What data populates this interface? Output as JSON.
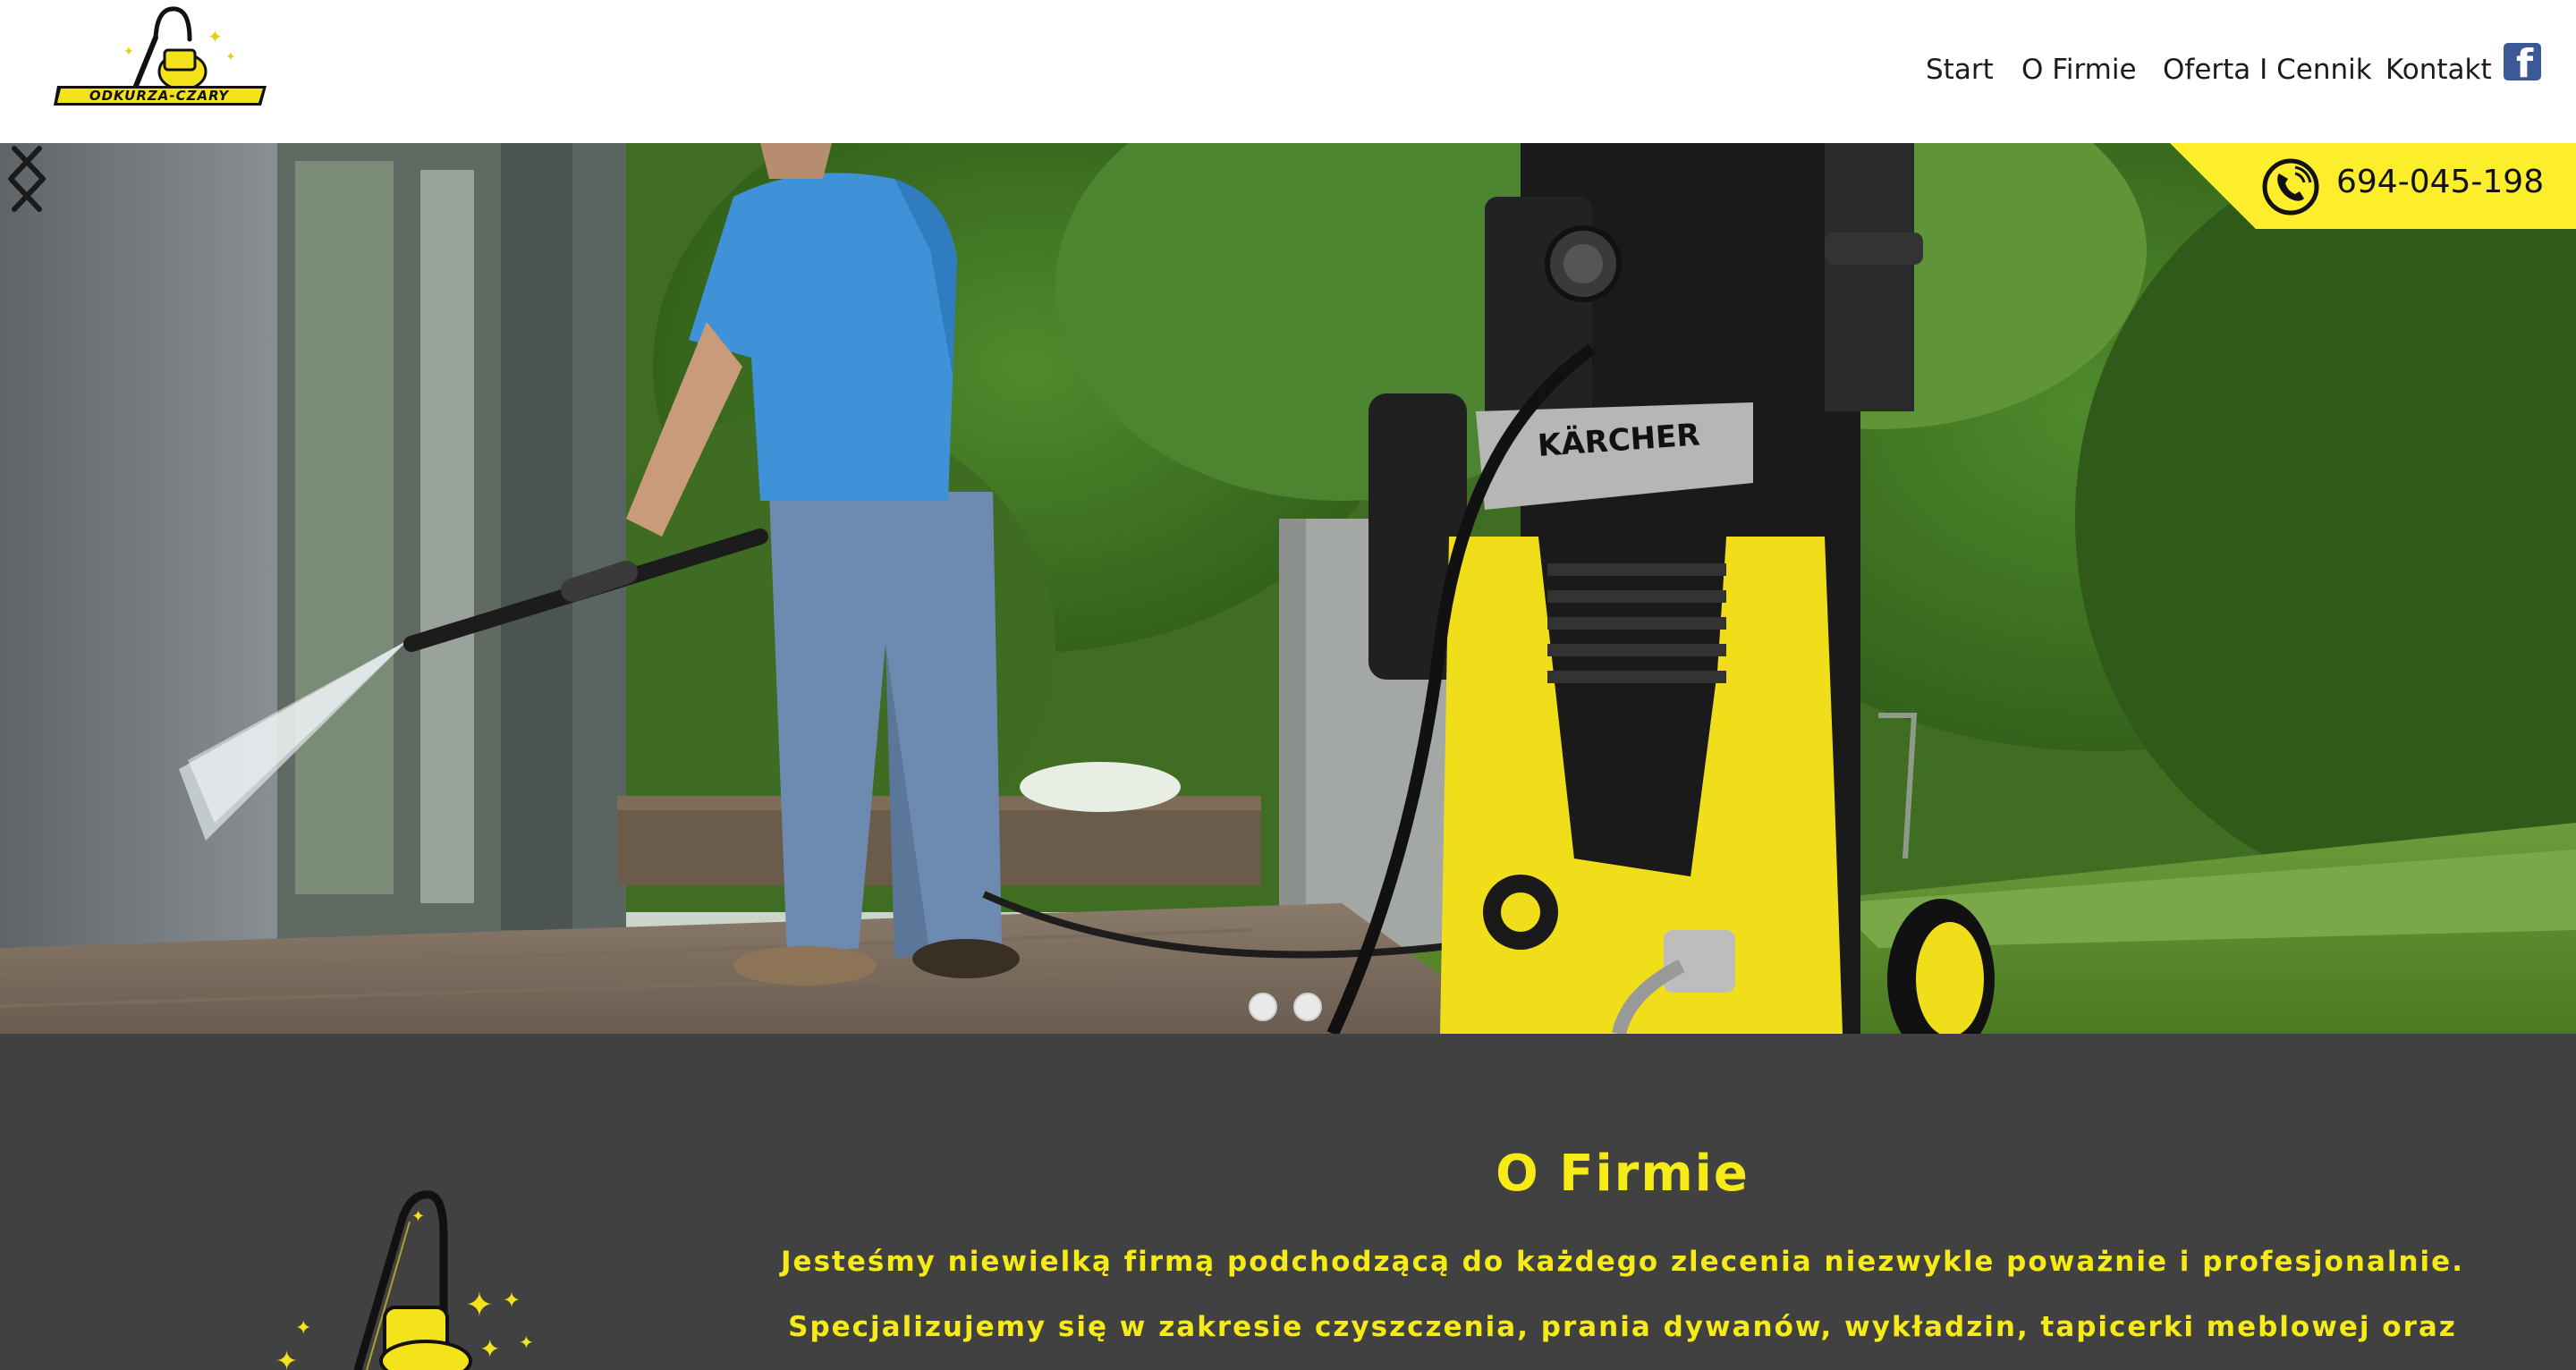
{
  "header": {
    "logo_text": "ODKURZA-CZARY",
    "nav": [
      {
        "label": "Start"
      },
      {
        "label": "O Firmie"
      },
      {
        "label": "Oferta I Cennik"
      },
      {
        "label": "Kontakt"
      }
    ],
    "facebook_icon": "facebook-icon"
  },
  "hero": {
    "phone": "694-045-198",
    "brand_on_device": "KÄRCHER",
    "slides_count": 2,
    "active_slide": 1
  },
  "about": {
    "title": "O Firmie",
    "lines": [
      "Jesteśmy niewielką firmą podchodzącą do każdego zlecenia niezwykle poważnie i profesjonalnie.",
      "Specjalizujemy się w zakresie czyszczenia, prania dywanów, wykładzin, tapicerki meblowej oraz"
    ]
  },
  "colors": {
    "accent_yellow": "#f6eb16",
    "dark_section": "#414141"
  }
}
